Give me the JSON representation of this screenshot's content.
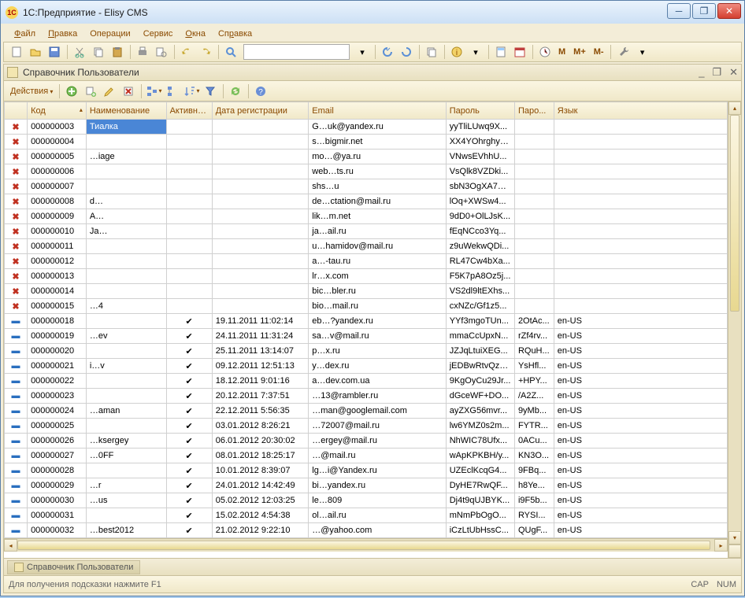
{
  "window": {
    "title": "1С:Предприятие - Elisy CMS"
  },
  "menu": {
    "file": "Файл",
    "edit": "Правка",
    "ops": "Операции",
    "service": "Сервис",
    "windows": "Окна",
    "help": "Справка"
  },
  "panel": {
    "title": "Справочник Пользователи",
    "min": "_",
    "restore": "❐",
    "close": "✕"
  },
  "actions": {
    "label": "Действия"
  },
  "columns": {
    "mark": "",
    "code": "Код",
    "name": "Наименование",
    "active": "Активный",
    "regdate": "Дата регистрации",
    "email": "Email",
    "pwd": "Пароль",
    "pwd2": "Паро...",
    "lang": "Язык"
  },
  "rows": [
    {
      "m": "del",
      "code": "000000003",
      "name": "Тиалка",
      "act": "",
      "date": "",
      "email": "G…uk@yandex.ru",
      "pwd": "yyTliLUwq9X...",
      "pwd2": "",
      "lang": "",
      "sel": true
    },
    {
      "m": "del",
      "code": "000000004",
      "name": "",
      "act": "",
      "date": "",
      "email": "s…bigmir.net",
      "pwd": "XX4YOhrghyo...",
      "pwd2": "",
      "lang": ""
    },
    {
      "m": "del",
      "code": "000000005",
      "name": "…iage",
      "act": "",
      "date": "",
      "email": "mo…@ya.ru",
      "pwd": "VNwsEVhhU...",
      "pwd2": "",
      "lang": ""
    },
    {
      "m": "del",
      "code": "000000006",
      "name": "",
      "act": "",
      "date": "",
      "email": "web…ts.ru",
      "pwd": "VsQlk8VZDki...",
      "pwd2": "",
      "lang": ""
    },
    {
      "m": "del",
      "code": "000000007",
      "name": "",
      "act": "",
      "date": "",
      "email": "shs…u",
      "pwd": "sbN3OgXA7Q...",
      "pwd2": "",
      "lang": ""
    },
    {
      "m": "del",
      "code": "000000008",
      "name": "d…",
      "act": "",
      "date": "",
      "email": "de…ctation@mail.ru",
      "pwd": "lOq+XWSw4...",
      "pwd2": "",
      "lang": ""
    },
    {
      "m": "del",
      "code": "000000009",
      "name": "A…",
      "act": "",
      "date": "",
      "email": "lik…m.net",
      "pwd": "9dD0+OlLJsK...",
      "pwd2": "",
      "lang": ""
    },
    {
      "m": "del",
      "code": "000000010",
      "name": "Ja…",
      "act": "",
      "date": "",
      "email": "ja…ail.ru",
      "pwd": "fEqNCco3Yq...",
      "pwd2": "",
      "lang": ""
    },
    {
      "m": "del",
      "code": "000000011",
      "name": "",
      "act": "",
      "date": "",
      "email": "u…hamidov@mail.ru",
      "pwd": "z9uWekwQDi...",
      "pwd2": "",
      "lang": ""
    },
    {
      "m": "del",
      "code": "000000012",
      "name": "",
      "act": "",
      "date": "",
      "email": "a…-tau.ru",
      "pwd": "RL47Cw4bXa...",
      "pwd2": "",
      "lang": ""
    },
    {
      "m": "del",
      "code": "000000013",
      "name": "",
      "act": "",
      "date": "",
      "email": "lr…x.com",
      "pwd": "F5K7pA8Oz5j...",
      "pwd2": "",
      "lang": ""
    },
    {
      "m": "del",
      "code": "000000014",
      "name": "",
      "act": "",
      "date": "",
      "email": "bic…bler.ru",
      "pwd": "VS2dl9ltEXhs...",
      "pwd2": "",
      "lang": ""
    },
    {
      "m": "del",
      "code": "000000015",
      "name": "…4",
      "act": "",
      "date": "",
      "email": "bio…mail.ru",
      "pwd": "cxNZc/Gf1z5...",
      "pwd2": "",
      "lang": ""
    },
    {
      "m": "act",
      "code": "000000018",
      "name": "",
      "act": "✔",
      "date": "19.11.2011 11:02:14",
      "email": "eb…?yandex.ru",
      "pwd": "YYf3mgoTUn...",
      "pwd2": "2OtAc...",
      "lang": "en-US"
    },
    {
      "m": "act",
      "code": "000000019",
      "name": "…ev",
      "act": "✔",
      "date": "24.11.2011 11:31:24",
      "email": "sa…v@mail.ru",
      "pwd": "mmaCcUpxN...",
      "pwd2": "rZf4rv...",
      "lang": "en-US"
    },
    {
      "m": "act",
      "code": "000000020",
      "name": "",
      "act": "✔",
      "date": "25.11.2011 13:14:07",
      "email": "p…x.ru",
      "pwd": "JZJqLtuiXEG...",
      "pwd2": "RQuH...",
      "lang": "en-US"
    },
    {
      "m": "act",
      "code": "000000021",
      "name": "i…v",
      "act": "✔",
      "date": "09.12.2011 12:51:13",
      "email": "y…dex.ru",
      "pwd": "jEDBwRtvQzX...",
      "pwd2": "YsHfl...",
      "lang": "en-US"
    },
    {
      "m": "act",
      "code": "000000022",
      "name": "",
      "act": "✔",
      "date": "18.12.2011 9:01:16",
      "email": "a…dev.com.ua",
      "pwd": "9KgOyCu29Jr...",
      "pwd2": "+HPY...",
      "lang": "en-US"
    },
    {
      "m": "act",
      "code": "000000023",
      "name": "",
      "act": "✔",
      "date": "20.12.2011 7:37:51",
      "email": "…13@rambler.ru",
      "pwd": "dGceWF+DO...",
      "pwd2": "/A2Z...",
      "lang": "en-US"
    },
    {
      "m": "act",
      "code": "000000024",
      "name": "…aman",
      "act": "✔",
      "date": "22.12.2011 5:56:35",
      "email": "…man@googlemail.com",
      "pwd": "ayZXG56mvr...",
      "pwd2": "9yMb...",
      "lang": "en-US"
    },
    {
      "m": "act",
      "code": "000000025",
      "name": "",
      "act": "✔",
      "date": "03.01.2012 8:26:21",
      "email": "…72007@mail.ru",
      "pwd": "lw6YMZ0s2m...",
      "pwd2": "FYTR...",
      "lang": "en-US"
    },
    {
      "m": "act",
      "code": "000000026",
      "name": "…ksergey",
      "act": "✔",
      "date": "06.01.2012 20:30:02",
      "email": "…ergey@mail.ru",
      "pwd": "NhWIC78Ufx...",
      "pwd2": "0ACu...",
      "lang": "en-US"
    },
    {
      "m": "act",
      "code": "000000027",
      "name": "…0FF",
      "act": "✔",
      "date": "08.01.2012 18:25:17",
      "email": "…@mail.ru",
      "pwd": "wApKPKBH/y...",
      "pwd2": "KN3O...",
      "lang": "en-US"
    },
    {
      "m": "act",
      "code": "000000028",
      "name": "",
      "act": "✔",
      "date": "10.01.2012 8:39:07",
      "email": "lg…i@Yandex.ru",
      "pwd": "UZEclKcqG4...",
      "pwd2": "9FBq...",
      "lang": "en-US"
    },
    {
      "m": "act",
      "code": "000000029",
      "name": "…r",
      "act": "✔",
      "date": "24.01.2012 14:42:49",
      "email": "bi…yandex.ru",
      "pwd": "DyHE7RwQF...",
      "pwd2": "h8Ye...",
      "lang": "en-US"
    },
    {
      "m": "act",
      "code": "000000030",
      "name": "…us",
      "act": "✔",
      "date": "05.02.2012 12:03:25",
      "email": "le…809",
      "pwd": "Dj4t9qUJBYK...",
      "pwd2": "i9F5b...",
      "lang": "en-US"
    },
    {
      "m": "act",
      "code": "000000031",
      "name": "",
      "act": "✔",
      "date": "15.02.2012 4:54:38",
      "email": "ol…ail.ru",
      "pwd": "mNmPbOgO...",
      "pwd2": "RYSI...",
      "lang": "en-US"
    },
    {
      "m": "act",
      "code": "000000032",
      "name": "…best2012",
      "act": "✔",
      "date": "21.02.2012 9:22:10",
      "email": "…@yahoo.com",
      "pwd": "iCzLtUbHssC...",
      "pwd2": "QUgF...",
      "lang": "en-US"
    }
  ],
  "taskbar": {
    "tab": "Справочник Пользователи"
  },
  "status": {
    "hint": "Для получения подсказки нажмите F1",
    "cap": "CAP",
    "num": "NUM"
  },
  "toolbar_text": {
    "m": "M",
    "mplus": "M+",
    "mminus": "M-"
  }
}
